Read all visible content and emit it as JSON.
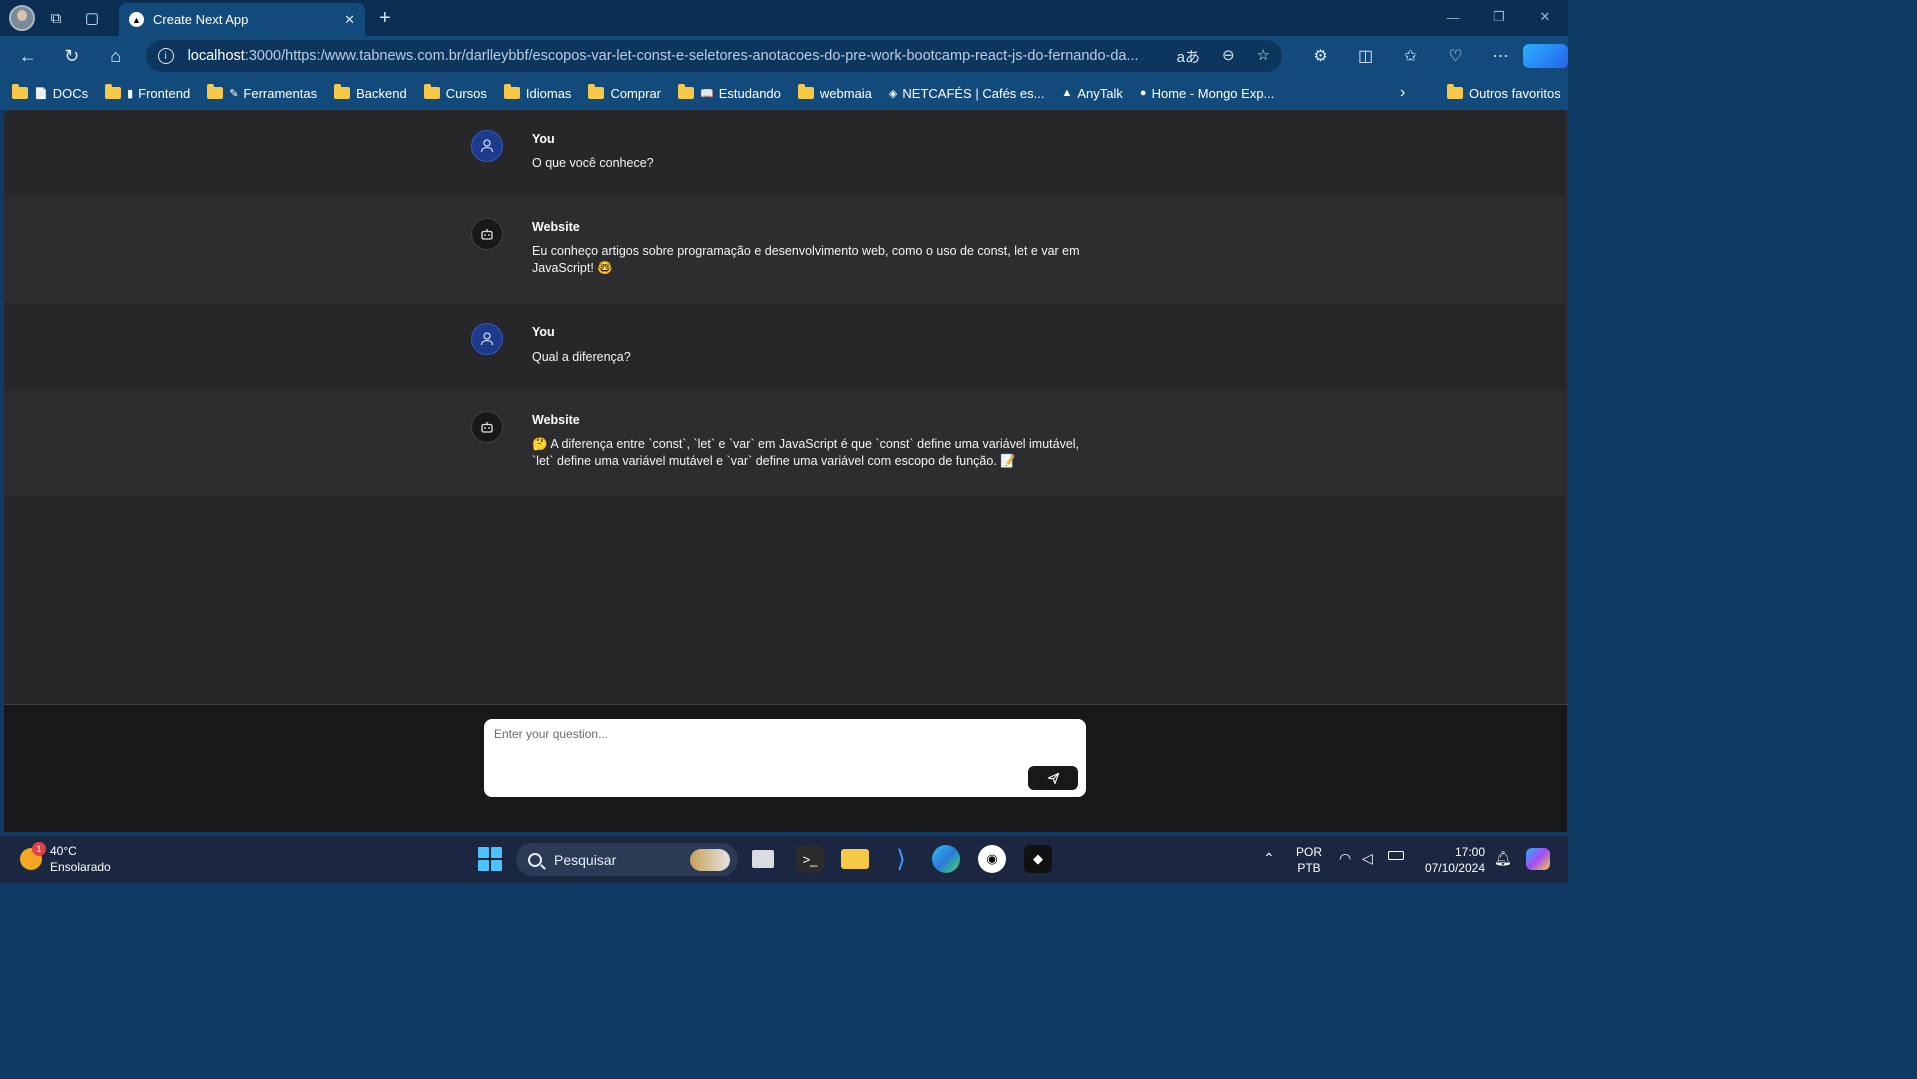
{
  "browser": {
    "tab_title": "Create Next App",
    "tab_favicon": "▲",
    "url_host": "localhost",
    "url_rest": ":3000/https:/www.tabnews.com.br/darlleybbf/escopos-var-let-const-e-seletores-anotacoes-do-pre-work-bootcamp-react-js-do-fernando-da..."
  },
  "bookmarks": {
    "items": [
      {
        "label": "DOCs",
        "glyph": "📄"
      },
      {
        "label": "Frontend",
        "glyph": "▮"
      },
      {
        "label": "Ferramentas",
        "glyph": "✎"
      },
      {
        "label": "Backend",
        "glyph": ""
      },
      {
        "label": "Cursos",
        "glyph": ""
      },
      {
        "label": "Idiomas",
        "glyph": ""
      },
      {
        "label": "Comprar",
        "glyph": ""
      },
      {
        "label": "Estudando",
        "glyph": "📖"
      },
      {
        "label": "webmaia",
        "glyph": ""
      },
      {
        "label": "NETCAFÉS | Cafés es...",
        "glyph": "◈"
      },
      {
        "label": "AnyTalk",
        "glyph": "▲"
      },
      {
        "label": "Home - Mongo Exp...",
        "glyph": "●"
      }
    ],
    "other": "Outros favoritos"
  },
  "chat": {
    "messages": [
      {
        "author": "You",
        "text": "O que você conhece?"
      },
      {
        "author": "Website",
        "text": "Eu conheço artigos sobre programação e desenvolvimento web, como o uso de const, let e var em JavaScript! 🤓"
      },
      {
        "author": "You",
        "text": "Qual a diferença?"
      },
      {
        "author": "Website",
        "text": "🤔 A diferença entre `const`, `let` e `var` em JavaScript é que `const` define uma variável imutável, `let` define uma variável mutável e `var` define uma variável com escopo de função. 📝"
      }
    ],
    "input_placeholder": "Enter your question..."
  },
  "taskbar": {
    "temperature": "40°C",
    "weather": "Ensolarado",
    "weather_badge": "1",
    "search_label": "Pesquisar",
    "lang_1": "POR",
    "lang_2": "PTB",
    "time": "17:00",
    "date": "07/10/2024"
  },
  "colors": {
    "page_bg": "#27272a",
    "bot_row_bg": "#2d2d30",
    "user_avatar": "#1e3a8a",
    "browser_frame": "#134a7c"
  }
}
